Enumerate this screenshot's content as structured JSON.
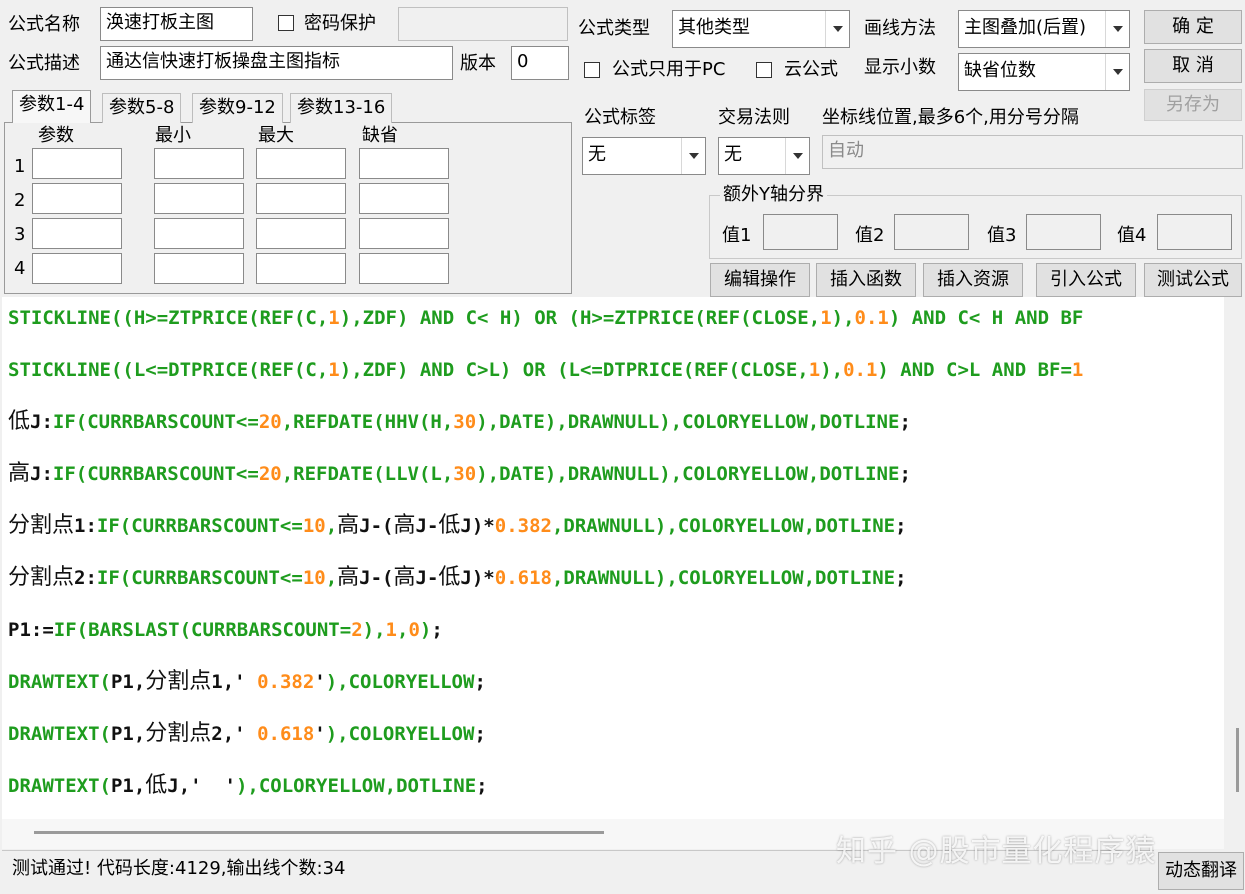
{
  "top": {
    "formula_name_label": "公式名称",
    "formula_name_value": "涣速打板主图",
    "password_label": "密码保护",
    "formula_desc_label": "公式描述",
    "formula_desc_value": "通达信快速打板操盘主图指标",
    "version_label": "版本",
    "version_value": "0",
    "formula_type_label": "公式类型",
    "formula_type_value": "其他类型",
    "draw_method_label": "画线方法",
    "draw_method_value": "主图叠加(后置)",
    "pc_only_label": "公式只用于PC",
    "cloud_label": "云公式",
    "decimal_label": "显示小数",
    "decimal_value": "缺省位数"
  },
  "buttons": {
    "confirm": "确  定",
    "cancel": "取  消",
    "save_as": "另存为",
    "edit_op": "编辑操作",
    "insert_func": "插入函数",
    "insert_res": "插入资源",
    "import_formula": "引入公式",
    "test_formula": "测试公式",
    "dynamic_translate": "动态翻译"
  },
  "tabs": [
    "参数1-4",
    "参数5-8",
    "参数9-12",
    "参数13-16"
  ],
  "params": {
    "headers": [
      "参数",
      "最小",
      "最大",
      "缺省"
    ],
    "rows": [
      "1",
      "2",
      "3",
      "4"
    ]
  },
  "tags": {
    "formula_tag_label": "公式标签",
    "formula_tag_value": "无",
    "trade_rule_label": "交易法则",
    "trade_rule_value": "无",
    "coord_label": "坐标线位置,最多6个,用分号分隔",
    "coord_value": "自动"
  },
  "yaxis": {
    "title": "额外Y轴分界",
    "labels": [
      "值1",
      "值2",
      "值3",
      "值4"
    ]
  },
  "code": [
    [
      [
        "k",
        "STICKLINE((H>=ZTPRICE(REF(C,"
      ],
      [
        "n",
        "1"
      ],
      [
        "k",
        "),ZDF) AND C< H) OR (H>=ZTPRICE(REF(CLOSE,"
      ],
      [
        "n",
        "1"
      ],
      [
        "k",
        "),"
      ],
      [
        "n",
        "0.1"
      ],
      [
        "k",
        ") AND C< H AND BF"
      ]
    ],
    [
      [
        "k",
        "STICKLINE((L<=DTPRICE(REF(C,"
      ],
      [
        "n",
        "1"
      ],
      [
        "k",
        "),ZDF) AND C>L) OR (L<=DTPRICE(REF(CLOSE,"
      ],
      [
        "n",
        "1"
      ],
      [
        "k",
        "),"
      ],
      [
        "n",
        "0.1"
      ],
      [
        "k",
        ") AND C>L AND BF="
      ],
      [
        "n",
        "1"
      ]
    ],
    [
      [
        "c",
        "低"
      ],
      [
        "b",
        "J:"
      ],
      [
        "k",
        "IF(CURRBARSCOUNT<="
      ],
      [
        "n",
        "20"
      ],
      [
        "k",
        ",REFDATE(HHV(H,"
      ],
      [
        "n",
        "30"
      ],
      [
        "k",
        "),DATE),DRAWNULL),COLORYELLOW,DOTLINE"
      ],
      [
        "b",
        ";"
      ]
    ],
    [
      [
        "c",
        "高"
      ],
      [
        "b",
        "J:"
      ],
      [
        "k",
        "IF(CURRBARSCOUNT<="
      ],
      [
        "n",
        "20"
      ],
      [
        "k",
        ",REFDATE(LLV(L,"
      ],
      [
        "n",
        "30"
      ],
      [
        "k",
        "),DATE),DRAWNULL),COLORYELLOW,DOTLINE"
      ],
      [
        "b",
        ";"
      ]
    ],
    [
      [
        "c",
        "分割点"
      ],
      [
        "b",
        "1:"
      ],
      [
        "k",
        "IF(CURRBARSCOUNT<="
      ],
      [
        "n",
        "10"
      ],
      [
        "k",
        ","
      ],
      [
        "c",
        "高"
      ],
      [
        "b",
        "J-("
      ],
      [
        "c",
        "高"
      ],
      [
        "b",
        "J-"
      ],
      [
        "c",
        "低"
      ],
      [
        "b",
        "J)*"
      ],
      [
        "n",
        "0.382"
      ],
      [
        "k",
        ",DRAWNULL),COLORYELLOW,DOTLINE"
      ],
      [
        "b",
        ";"
      ]
    ],
    [
      [
        "c",
        "分割点"
      ],
      [
        "b",
        "2:"
      ],
      [
        "k",
        "IF(CURRBARSCOUNT<="
      ],
      [
        "n",
        "10"
      ],
      [
        "k",
        ","
      ],
      [
        "c",
        "高"
      ],
      [
        "b",
        "J-("
      ],
      [
        "c",
        "高"
      ],
      [
        "b",
        "J-"
      ],
      [
        "c",
        "低"
      ],
      [
        "b",
        "J)*"
      ],
      [
        "n",
        "0.618"
      ],
      [
        "k",
        ",DRAWNULL),COLORYELLOW,DOTLINE"
      ],
      [
        "b",
        ";"
      ]
    ],
    [
      [
        "b",
        "P1:="
      ],
      [
        "k",
        "IF(BARSLAST(CURRBARSCOUNT="
      ],
      [
        "n",
        "2"
      ],
      [
        "k",
        "),"
      ],
      [
        "n",
        "1"
      ],
      [
        "k",
        ","
      ],
      [
        "n",
        "0"
      ],
      [
        "k",
        ")"
      ],
      [
        "b",
        ";"
      ]
    ],
    [
      [
        "k",
        "DRAWTEXT("
      ],
      [
        "b",
        "P1,"
      ],
      [
        "c",
        "分割点"
      ],
      [
        "b",
        "1,' "
      ],
      [
        "n",
        "0.382"
      ],
      [
        "b",
        "'"
      ],
      [
        "k",
        "),COLORYELLOW"
      ],
      [
        "b",
        ";"
      ]
    ],
    [
      [
        "k",
        "DRAWTEXT("
      ],
      [
        "b",
        "P1,"
      ],
      [
        "c",
        "分割点"
      ],
      [
        "b",
        "2,' "
      ],
      [
        "n",
        "0.618"
      ],
      [
        "b",
        "'"
      ],
      [
        "k",
        "),COLORYELLOW"
      ],
      [
        "b",
        ";"
      ]
    ],
    [
      [
        "k",
        "DRAWTEXT("
      ],
      [
        "b",
        "P1,"
      ],
      [
        "c",
        "低"
      ],
      [
        "b",
        "J,'  '"
      ],
      [
        "k",
        "),COLORYELLOW,DOTLINE"
      ],
      [
        "b",
        ";"
      ]
    ]
  ],
  "status": "测试通过! 代码长度:4129,输出线个数:34",
  "watermark": "知乎 @股市量化程序猿",
  "colors": {
    "keyword": "#1e9c1e",
    "number": "#ff8c1a"
  }
}
